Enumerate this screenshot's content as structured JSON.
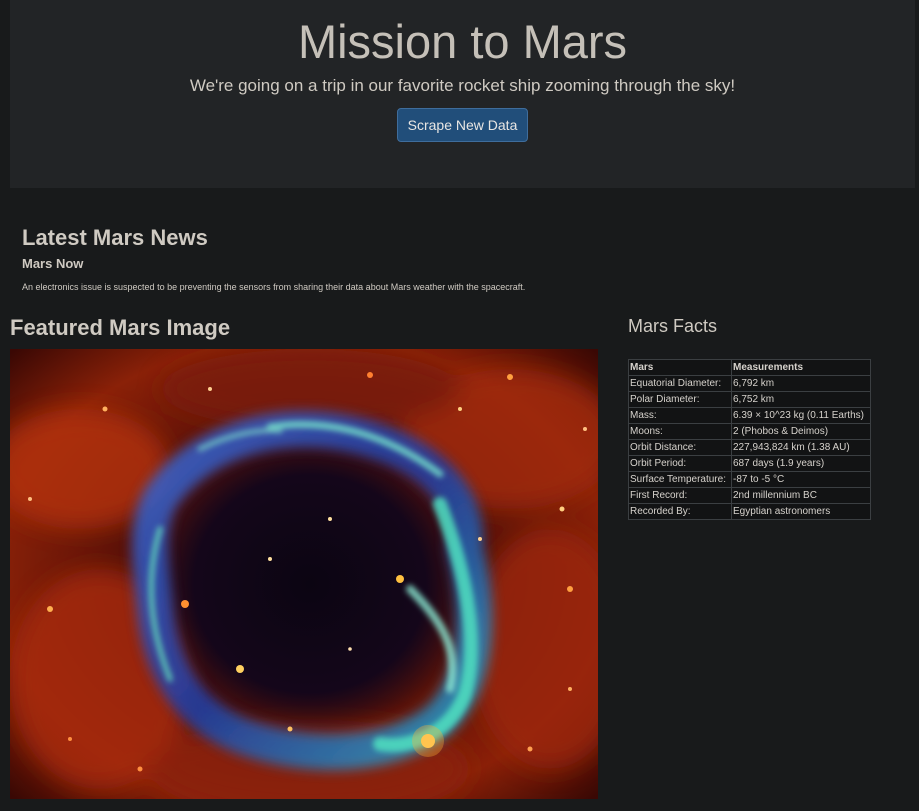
{
  "jumbotron": {
    "title": "Mission to Mars",
    "lead": "We're going on a trip in our favorite rocket ship zooming through the sky!",
    "button_label": "Scrape New Data"
  },
  "news": {
    "heading": "Latest Mars News",
    "title": "Mars Now",
    "teaser": "An electronics issue is suspected to be preventing the sensors from sharing their data about Mars weather with the spacecraft."
  },
  "featured": {
    "heading": "Featured Mars Image"
  },
  "facts": {
    "heading": "Mars Facts",
    "columns": [
      "Mars",
      "Measurements"
    ],
    "rows": [
      [
        "Equatorial Diameter:",
        "6,792 km"
      ],
      [
        "Polar Diameter:",
        "6,752 km"
      ],
      [
        "Mass:",
        "6.39 × 10^23 kg (0.11 Earths)"
      ],
      [
        "Moons:",
        "2 (Phobos & Deimos)"
      ],
      [
        "Orbit Distance:",
        "227,943,824 km (1.38 AU)"
      ],
      [
        "Orbit Period:",
        "687 days (1.9 years)"
      ],
      [
        "Surface Temperature:",
        "-87 to -5 °C"
      ],
      [
        "First Record:",
        "2nd millennium BC"
      ],
      [
        "Recorded By:",
        "Egyptian astronomers"
      ]
    ]
  },
  "colors": {
    "page_background": "#181a1b",
    "jumbotron_background": "#222426",
    "button_background": "#214e7a",
    "text": "#cfcac2"
  }
}
